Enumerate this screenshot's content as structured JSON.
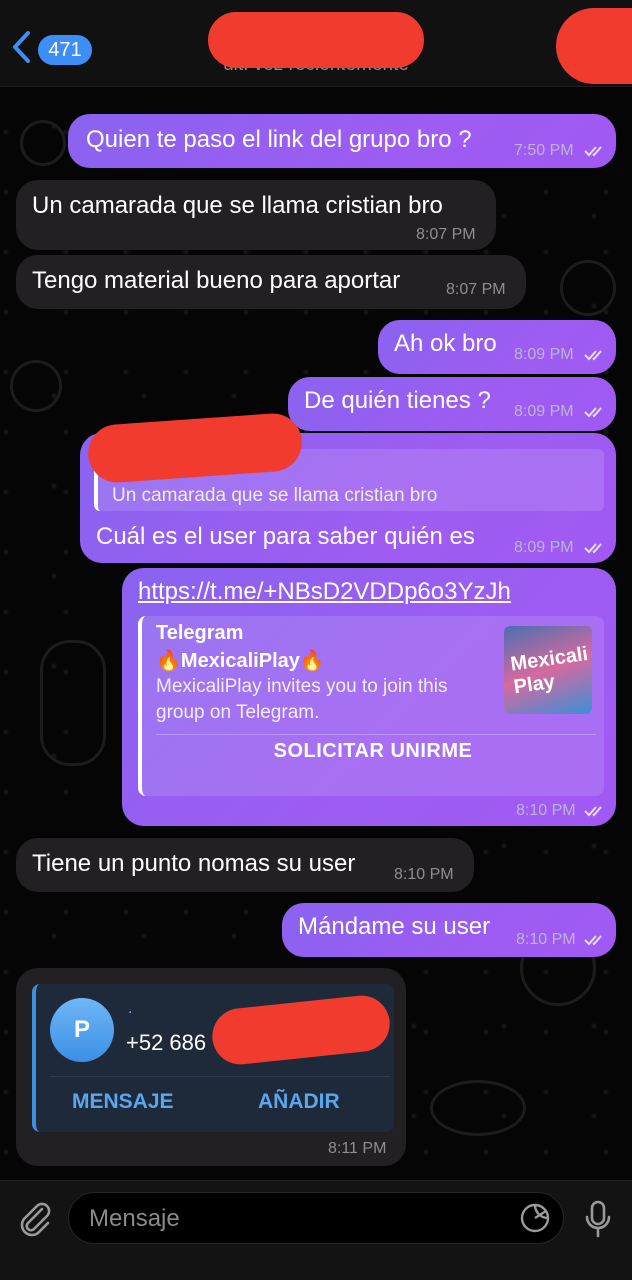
{
  "header": {
    "back_count": "471",
    "status": "últ. vez recientemente"
  },
  "messages": [
    {
      "id": "m1",
      "side": "out",
      "text": "Quien te paso el link del grupo bro ?",
      "time": "7:50 PM"
    },
    {
      "id": "m2",
      "side": "in",
      "text": "Un camarada que se llama cristian bro",
      "time": "8:07 PM"
    },
    {
      "id": "m3",
      "side": "in",
      "text": "Tengo material bueno para aportar",
      "time": "8:07 PM"
    },
    {
      "id": "m4",
      "side": "out",
      "text": "Ah ok bro",
      "time": "8:09 PM"
    },
    {
      "id": "m5",
      "side": "out",
      "text": "De quién tienes ?",
      "time": "8:09 PM"
    },
    {
      "id": "m6",
      "side": "out",
      "reply_quote": "Un camarada que se llama cristian bro",
      "text": "Cuál es el user para saber quién es",
      "time": "8:09 PM"
    },
    {
      "id": "m7",
      "side": "out",
      "link": "https://t.me/+NBsD2VDDp6o3YzJh",
      "time": "8:10 PM",
      "preview": {
        "site": "Telegram",
        "title": "🔥MexicaliPlay🔥",
        "description": "MexicaliPlay invites you to join this group on Telegram.",
        "button": "SOLICITAR UNIRME",
        "thumb_text": "Mexicali Play"
      }
    },
    {
      "id": "m8",
      "side": "in",
      "text": "Tiene un punto nomas su user",
      "time": "8:10 PM"
    },
    {
      "id": "m9",
      "side": "out",
      "text": "Mándame su user",
      "time": "8:10 PM"
    },
    {
      "id": "m10",
      "side": "in",
      "time": "8:11 PM",
      "contact": {
        "initial": "P",
        "name": ".",
        "phone": "+52 686",
        "message_button": "MENSAJE",
        "add_button": "AÑADIR"
      }
    }
  ],
  "input": {
    "placeholder": "Mensaje"
  },
  "colors": {
    "accent": "#3e8ef7",
    "outgoing": "#9a5ef2",
    "incoming": "#232024",
    "redaction": "#f23b2f"
  },
  "icons": [
    "back-chevron-icon",
    "read-check-icon",
    "attach-icon",
    "sticker-icon",
    "mic-icon"
  ]
}
